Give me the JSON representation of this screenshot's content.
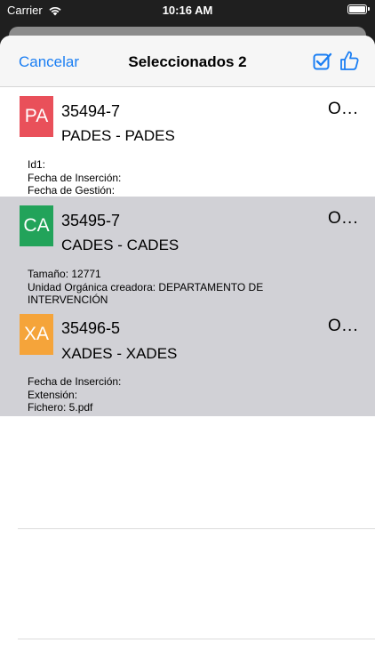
{
  "status_bar": {
    "carrier": "Carrier",
    "time": "10:16 AM"
  },
  "nav": {
    "cancel_label": "Cancelar",
    "title": "Seleccionados 2"
  },
  "items": [
    {
      "badge": "PA",
      "badge_color": "#e9505a",
      "code": "35494-7",
      "name": "PADES - PADES",
      "more": "O...",
      "selected": false,
      "details": [
        "Id1:",
        "Fecha de Inserción:",
        "Fecha de Gestión:"
      ]
    },
    {
      "badge": "CA",
      "badge_color": "#22a35a",
      "code": "35495-7",
      "name": "CADES - CADES",
      "more": "O...",
      "selected": true,
      "details": [
        "Tamaño:  12771",
        "Unidad Orgánica creadora:  DEPARTAMENTO DE",
        "INTERVENCIÓN"
      ]
    },
    {
      "badge": "XA",
      "badge_color": "#f5a43a",
      "code": "35496-5",
      "name": "XADES - XADES",
      "more": "O...",
      "selected": true,
      "details": [
        "Fecha de Inserción:",
        "Extensión:",
        "Fichero:  5.pdf"
      ]
    }
  ]
}
